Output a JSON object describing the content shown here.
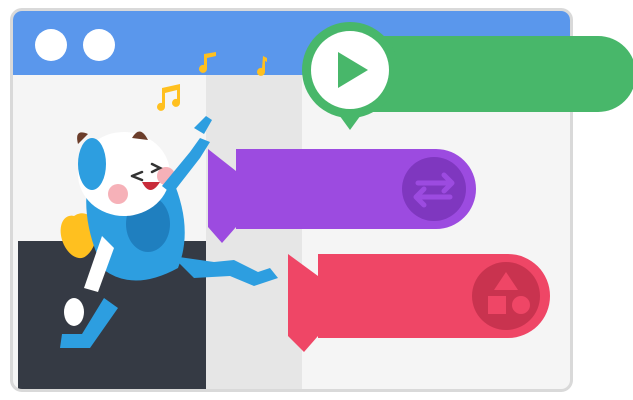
{
  "colors": {
    "window_bg": "#f5f5f5",
    "window_border": "#d9d9d9",
    "titlebar": "#5a97ec",
    "dots": "#ffffff",
    "palette_column": "#e6e6e6",
    "stage": "#353a44",
    "green_block": "#48b76a",
    "green_icon_border": "#48b76a",
    "purple_block": "#9c4be0",
    "purple_icon_circle": "#7f37bf",
    "red_block": "#ef4666",
    "red_icon_circle": "#c9334f",
    "notes": "#ffc01f",
    "mascot_blue": "#2d9ee0",
    "mascot_white": "#ffffff"
  },
  "icons": {
    "start": "play-icon",
    "swap": "swap-arrows-icon",
    "shapes": "shapes-icon",
    "note": "music-note-icon"
  }
}
